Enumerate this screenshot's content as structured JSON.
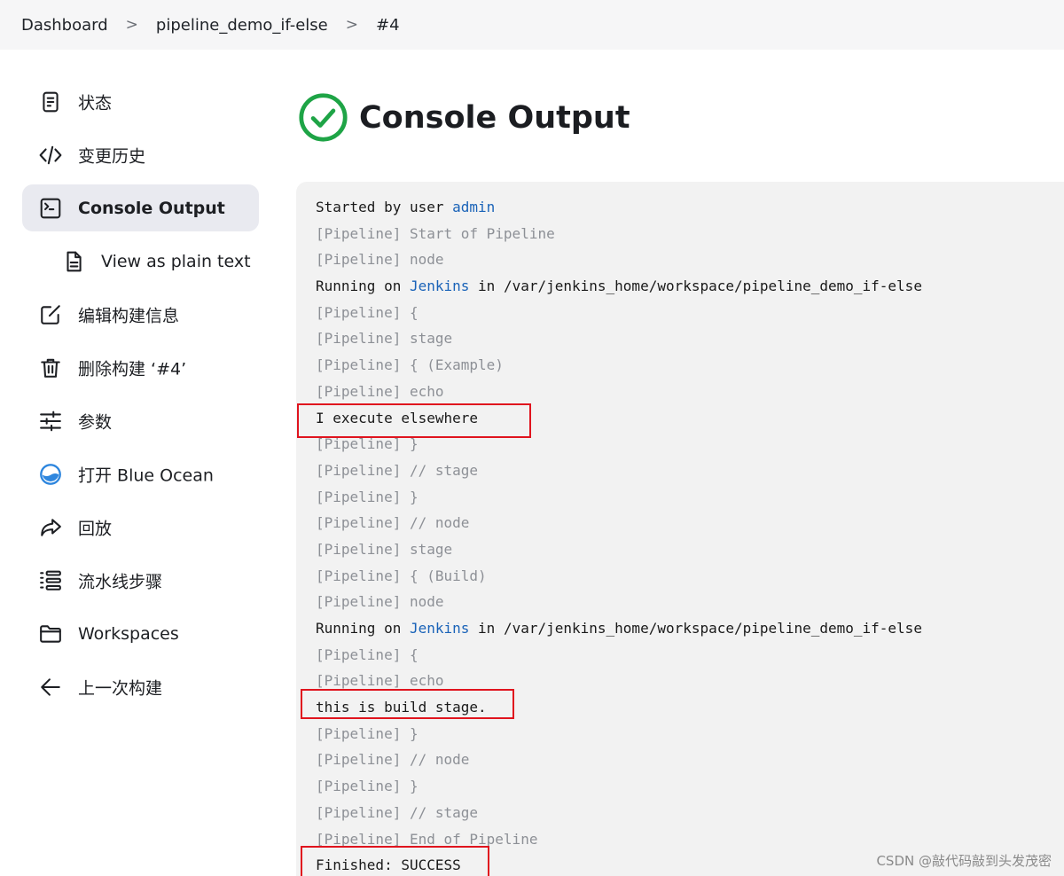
{
  "breadcrumb": [
    "Dashboard",
    "pipeline_demo_if-else",
    "#4"
  ],
  "breadcrumb_sep": ">",
  "sidebar": {
    "items": [
      {
        "label": "状态",
        "icon": "document-icon"
      },
      {
        "label": "变更历史",
        "icon": "code-icon"
      },
      {
        "label": "Console Output",
        "icon": "terminal-icon",
        "active": true
      },
      {
        "label": "View as plain text",
        "icon": "file-text-icon"
      },
      {
        "label": "编辑构建信息",
        "icon": "edit-icon"
      },
      {
        "label": "删除构建 ‘#4’",
        "icon": "trash-icon"
      },
      {
        "label": "参数",
        "icon": "sliders-icon"
      },
      {
        "label": "打开 Blue Ocean",
        "icon": "blue-ocean-icon"
      },
      {
        "label": "回放",
        "icon": "replay-icon"
      },
      {
        "label": "流水线步骤",
        "icon": "list-icon"
      },
      {
        "label": "Workspaces",
        "icon": "folder-icon"
      },
      {
        "label": "上一次构建",
        "icon": "arrow-left-icon"
      }
    ]
  },
  "page": {
    "title": "Console Output",
    "status": "success",
    "status_icon": "check-circle-icon",
    "status_color": "#1ea446"
  },
  "console": {
    "prefix": "[Pipeline]",
    "started_by": "Started by user ",
    "started_user": "admin",
    "running_on": "Running on ",
    "agent": "Jenkins",
    "path": " in /var/jenkins_home/workspace/pipeline_demo_if-else",
    "lines": {
      "l1": " Start of Pipeline",
      "l2": " node",
      "l4": " {",
      "l5": " stage",
      "l6": " { (Example)",
      "l7": " echo",
      "l8": "I execute elsewhere",
      "l9": " }",
      "l10": " // stage",
      "l11": " }",
      "l12": " // node",
      "l13": " stage",
      "l14": " { (Build)",
      "l15": " node",
      "l17": " {",
      "l18": " echo",
      "l19": "this is build stage.",
      "l20": " }",
      "l21": " // node",
      "l22": " }",
      "l23": " // stage",
      "l24": " End of Pipeline",
      "l25": "Finished: SUCCESS"
    }
  },
  "highlight_color": "#e0141e",
  "link_color": "#1a63b8",
  "watermark": "CSDN @敲代码敲到头发茂密"
}
